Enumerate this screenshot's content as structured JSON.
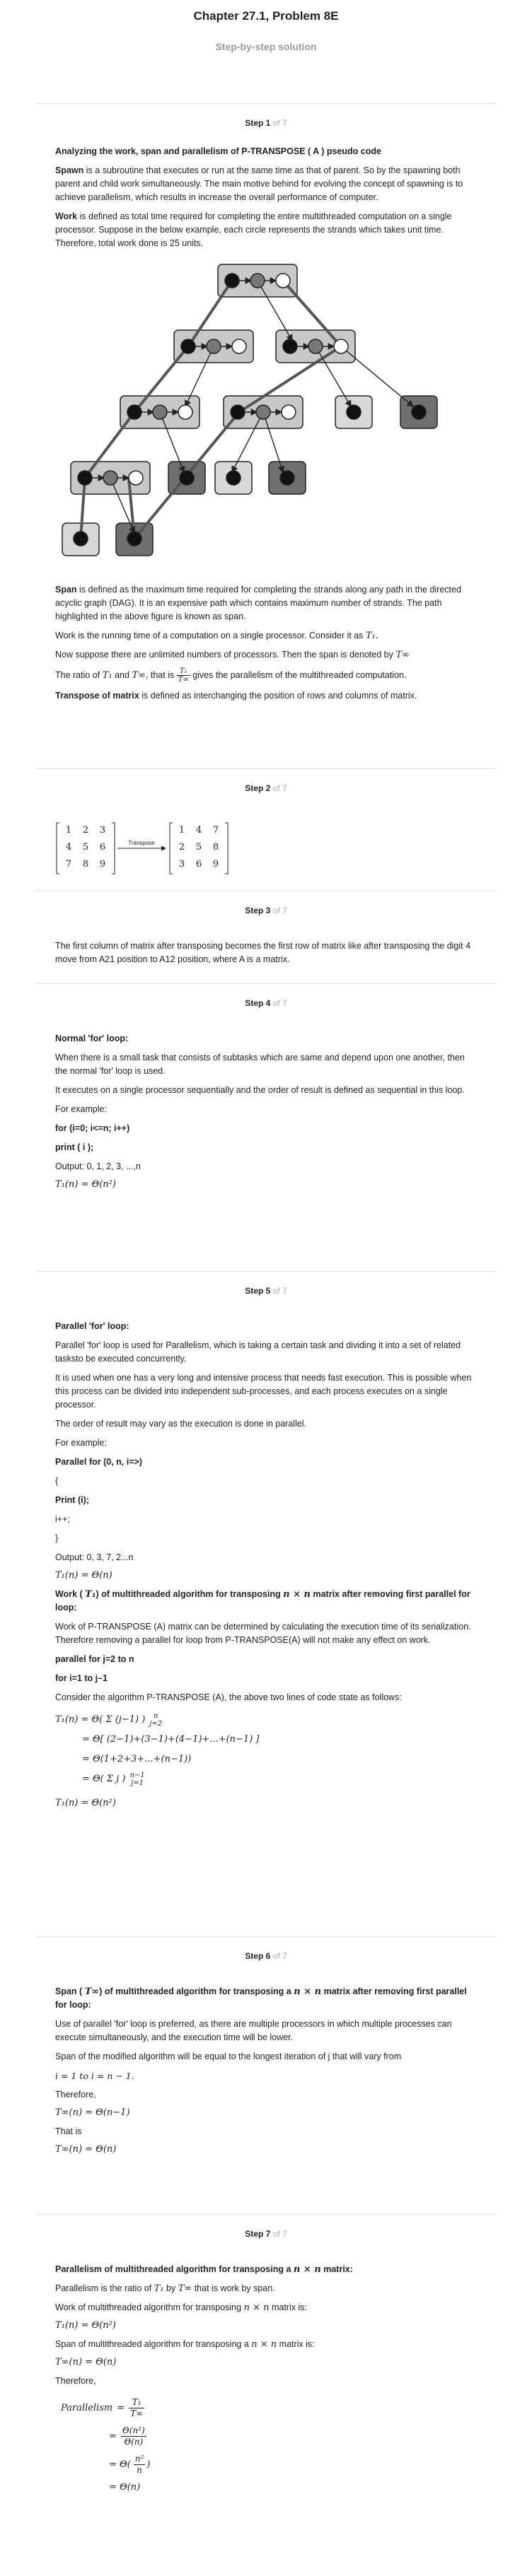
{
  "header": {
    "chapter": "Chapter 27.1, Problem 8E",
    "subtitle": "Step-by-step solution"
  },
  "steps": [
    {
      "n": "Step 1",
      "of": "of 7"
    },
    {
      "n": "Step 2",
      "of": "of 7"
    },
    {
      "n": "Step 3",
      "of": "of 7"
    },
    {
      "n": "Step 4",
      "of": "of 7"
    },
    {
      "n": "Step 5",
      "of": "of 7"
    },
    {
      "n": "Step 6",
      "of": "of 7"
    },
    {
      "n": "Step 7",
      "of": "of 7"
    }
  ],
  "step1": {
    "heading": "Analyzing the work, span and parallelism of P-TRANSPOSE ( A ) pseudo code",
    "spawn_term": "Spawn",
    "spawn_text": " is a subroutine that executes or run at the same time as that of parent. So by the spawning both parent and child work simultaneously. The main motive behind for evolving the concept of spawning is to achieve parallelism, which results in increase the overall performance of computer.",
    "work_term": "Work",
    "work_text": " is defined as total time required for completing the entire multithreaded computation on a single processor. Suppose in the below example, each circle represents the strands which takes unit time. Therefore, total work done is 25 units.",
    "span_term": "Span",
    "span_text": " is defined as the maximum time required for completing the strands along any path in the directed acyclic graph (DAG). It is an expensive path which contains maximum number of strands. The path highlighted in the above figure is known as span.",
    "running_text": "Work is the running time of a computation on a single processor. Consider it as",
    "running_sym": "T₁.",
    "numbered_text": "Now suppose there are unlimited numbers of processors. Then the span is denoted by",
    "numbered_sym": "T∞",
    "ratio_a": "The ratio of",
    "ratio_t1": "T₁",
    "ratio_and": "and",
    "ratio_tinf": "T∞",
    "ratio_that": ", that is",
    "ratio_num": "T₁",
    "ratio_den": "T∞",
    "ratio_end": "gives the parallelism of the multithreaded computation.",
    "transpose_term": "Transpose of matrix",
    "transpose_text": " is defined as interchanging the position of rows and columns of matrix."
  },
  "step2": {
    "matrix_a": [
      [
        "1",
        "2",
        "3"
      ],
      [
        "4",
        "5",
        "6"
      ],
      [
        "7",
        "8",
        "9"
      ]
    ],
    "matrix_b": [
      [
        "1",
        "4",
        "7"
      ],
      [
        "2",
        "5",
        "8"
      ],
      [
        "3",
        "6",
        "9"
      ]
    ],
    "arrow_label": "Transpose"
  },
  "step3": {
    "text": "The first column of matrix after transposing becomes the first row of matrix like after transposing the digit 4 move from A21 position to A12 position, where A is a matrix."
  },
  "step4": {
    "heading": "Normal 'for' loop:",
    "p1": "When there is a small task that consists of subtasks which are same and depend upon one another, then the normal 'for' loop is used.",
    "p2": "It executes on a single processor sequentially and the order of result is defined as sequential in this loop.",
    "example": "For example:",
    "code1": "for (i=0; i<=n; i++)",
    "code2": "print ( i );",
    "output": "Output: 0, 1, 2, 3, ...,n",
    "eq": "T₁(n) = Θ(n²)"
  },
  "step5": {
    "heading": "Parallel 'for' loop:",
    "p1": "Parallel 'for' loop is used for Parallelism, which is taking a certain task and dividing it into a set of related tasksto be executed concurrently.",
    "p2": "It is used when one has a very long and intensive process that needs fast execution. This is possible when this process can be divided into independent sub-processes, and each process executes on a single processor.",
    "p3": "The order of result may vary as the execution is done in parallel.",
    "example": "For example:",
    "code1": "Parallel for (0, n, i=>)",
    "code2": "{",
    "code3": "Print (i);",
    "code4": "i++;",
    "code5": "}",
    "output": "Output: 0, 3, 7, 2...n",
    "eq1": "T₁(n) = Θ(n)",
    "work_heading_a": "Work (",
    "work_heading_sym": "T₁",
    "work_heading_b": ") of multithreaded algorithm for transposing",
    "work_heading_dim": "n × n",
    "work_heading_c": "matrix after removing first parallel for loop:",
    "p4": "Work of P-TRANSPOSE (A) matrix can be determined by calculating the execution time of its serialization. Therefore removing a parallel for loop from P-TRANSPOSE(A) will not make any effect on work.",
    "code6": "parallel for j=2 to n",
    "code7": "for i=1 to j–1",
    "p5": "Consider the algorithm P-TRANSPOSE (A), the above two lines of code state as follows:",
    "d1": "T₁(n) = Θ( Σ (j−1) )",
    "d1_top": "n",
    "d1_bot": "j=2",
    "d2": "= Θ[ (2−1)+(3−1)+(4−1)+...+(n−1) ]",
    "d3": "= Θ(1+2+3+...+(n−1))",
    "d4": "= Θ( Σ j )",
    "d4_top": "n−1",
    "d4_bot": "j=1",
    "d5": "T₁(n) = Θ(n²)"
  },
  "step6": {
    "heading_a": "Span (",
    "heading_sym": "T∞",
    "heading_b": ") of multithreaded algorithm for transposing a",
    "heading_dim": "n × n",
    "heading_c": "matrix after removing first parallel for loop:",
    "p1": "Use of parallel 'for' loop is preferred, as there are multiple processors in which multiple processes can execute simultaneously, and the execution time will be lower.",
    "p2": "Span of the modified algorithm will be equal to the longest iteration of  j that will vary from",
    "range": "i = 1 to  i = n − 1.",
    "therefore": "Therefore,",
    "eq1": "T∞(n) = Θ(n−1)",
    "that_is": "That is",
    "eq2": "T∞(n) = Θ(n)"
  },
  "step7": {
    "heading_a": "Parallelism of multithreaded algorithm for transposing a",
    "heading_dim": "n × n",
    "heading_b": "matrix:",
    "p1_a": "Parallelism is the ratio of",
    "p1_t1": "T₁",
    "p1_by": "by",
    "p1_tinf": "T∞",
    "p1_b": "that is work by span.",
    "p2": "Work of multithreaded algorithm for transposing",
    "p2_dim": "n × n",
    "p2_b": "matrix is:",
    "eq1": "T₁(n) = Θ(n²)",
    "p3": "Span of multithreaded algorithm for transposing a",
    "p3_dim": "n × n",
    "p3_b": "matrix is:",
    "eq2": "T∞(n) = Θ(n)",
    "therefore": "Therefore,",
    "par_label": "Parallelism",
    "par_num": "T₁",
    "par_den": "T∞",
    "r1_num": "Θ(n²)",
    "r1_den": "Θ(n)",
    "r2_num": "n²",
    "r2_den": "n",
    "r3": "= Θ(n)"
  }
}
